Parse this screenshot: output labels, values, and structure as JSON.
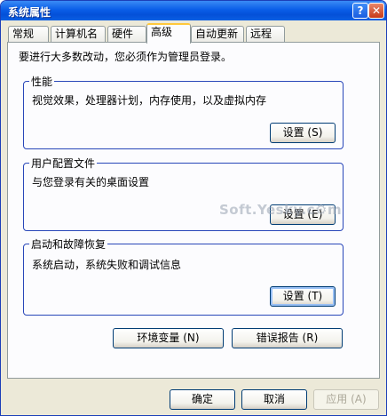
{
  "window": {
    "title": "系统属性",
    "help_glyph": "?",
    "close_glyph": "✕"
  },
  "tabs": [
    {
      "label": "常规"
    },
    {
      "label": "计算机名"
    },
    {
      "label": "硬件"
    },
    {
      "label": "高级"
    },
    {
      "label": "自动更新"
    },
    {
      "label": "远程"
    }
  ],
  "active_tab": "高级",
  "intro": "要进行大多数改动，您必须作为管理员登录。",
  "performance": {
    "label": "性能",
    "description": "视觉效果，处理器计划，内存使用，以及虚拟内存",
    "button": "设置 (S)"
  },
  "profiles": {
    "label": "用户配置文件",
    "description": "与您登录有关的桌面设置",
    "button": "设置 (E)"
  },
  "startup": {
    "label": "启动和故障恢复",
    "description": "系统启动，系统失败和调试信息",
    "button": "设置 (T)"
  },
  "env_button": "环境变量 (N)",
  "error_button": "错误报告 (R)",
  "footer": {
    "ok": "确定",
    "cancel": "取消",
    "apply": "应用 (A)"
  },
  "watermark": "Soft.Yesky.c⚙m",
  "colors": {
    "titlebar": "#0a5ee8",
    "face": "#ece9d8",
    "group_border": "#2947b9",
    "active_tab_accent": "#ffc83c"
  }
}
